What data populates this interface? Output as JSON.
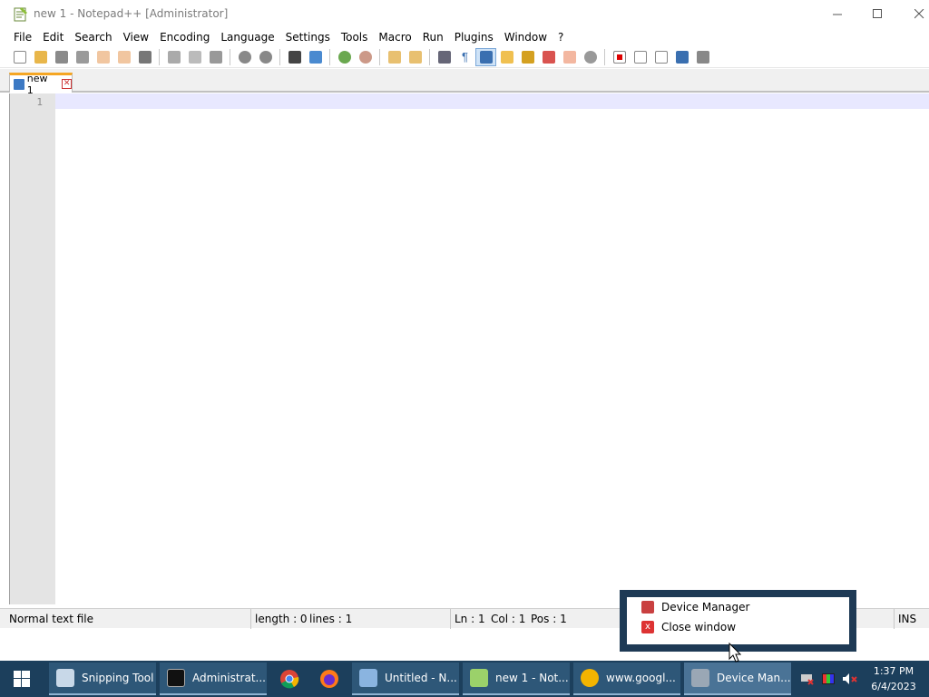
{
  "window": {
    "title": "new 1 - Notepad++ [Administrator]"
  },
  "menu": [
    "File",
    "Edit",
    "Search",
    "View",
    "Encoding",
    "Language",
    "Settings",
    "Tools",
    "Macro",
    "Run",
    "Plugins",
    "Window",
    "?"
  ],
  "tab": {
    "label": "new 1"
  },
  "editor": {
    "line_number": "1"
  },
  "status": {
    "filetype": "Normal text file",
    "length": "length : 0",
    "lines": "lines : 1",
    "ln": "Ln : 1",
    "col": "Col : 1",
    "pos": "Pos : 1",
    "mode": "INS"
  },
  "context_menu": {
    "items": [
      {
        "label": "Device Manager",
        "icon": "device-manager-icon"
      },
      {
        "label": "Close window",
        "icon": "close-window-icon"
      }
    ]
  },
  "taskbar": {
    "buttons": [
      {
        "label": "Snipping Tool",
        "icon": "snipping-tool-icon"
      },
      {
        "label": "Administrat...",
        "icon": "cmd-icon"
      },
      {
        "label": "Untitled - N...",
        "icon": "notepad-icon"
      },
      {
        "label": "new 1 - Not...",
        "icon": "notepadpp-icon"
      },
      {
        "label": "www.googl...",
        "icon": "chrome-icon"
      },
      {
        "label": "Device Man...",
        "icon": "device-manager-icon"
      }
    ],
    "time": "1:37 PM",
    "date": "6/4/2023"
  },
  "colors": {
    "taskbar": "#1c3f5c",
    "accent_tab": "#f5a623",
    "current_line": "#e8e8ff"
  }
}
